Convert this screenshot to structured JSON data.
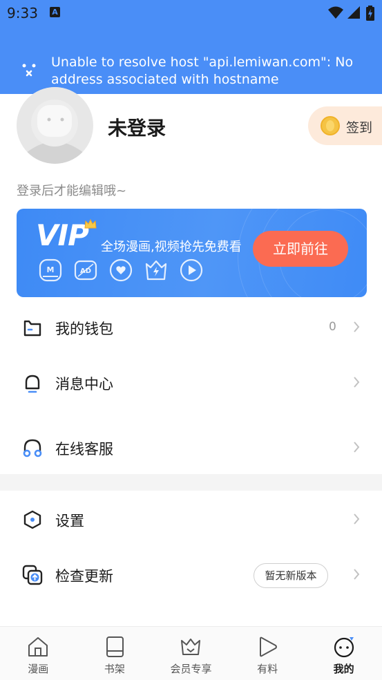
{
  "status_bar": {
    "time": "9:33",
    "notif_glyph": "A"
  },
  "toast": {
    "message": "Unable to resolve host \"api.lemiwan.com\": No address associated with hostname"
  },
  "profile": {
    "username": "未登录",
    "hint": "登录后才能编辑哦~",
    "signin_label": "签到"
  },
  "vip": {
    "logo": "VIP",
    "promo": "全场漫画,视频抢先免费看",
    "button": "立即前往",
    "perk_icons": [
      "manga-icon",
      "ad-icon",
      "heart-icon",
      "crown-icon",
      "play-icon"
    ]
  },
  "menu": [
    {
      "label": "我的钱包",
      "value": "0",
      "icon": "wallet-icon"
    },
    {
      "label": "消息中心",
      "icon": "bell-icon"
    },
    {
      "label": "在线客服",
      "icon": "headset-icon"
    },
    {
      "label": "设置",
      "icon": "settings-icon"
    },
    {
      "label": "检查更新",
      "badge": "暂无新版本",
      "icon": "update-icon"
    }
  ],
  "tabs": [
    {
      "label": "漫画",
      "icon": "home-icon"
    },
    {
      "label": "书架",
      "icon": "book-icon"
    },
    {
      "label": "会员专享",
      "icon": "vip-crown-icon"
    },
    {
      "label": "有料",
      "icon": "play-icon"
    },
    {
      "label": "我的",
      "icon": "profile-face-icon",
      "active": true
    }
  ],
  "colors": {
    "primary": "#4a8ef7",
    "accent": "#fb6b52",
    "signin_bg": "#fdeadb"
  }
}
